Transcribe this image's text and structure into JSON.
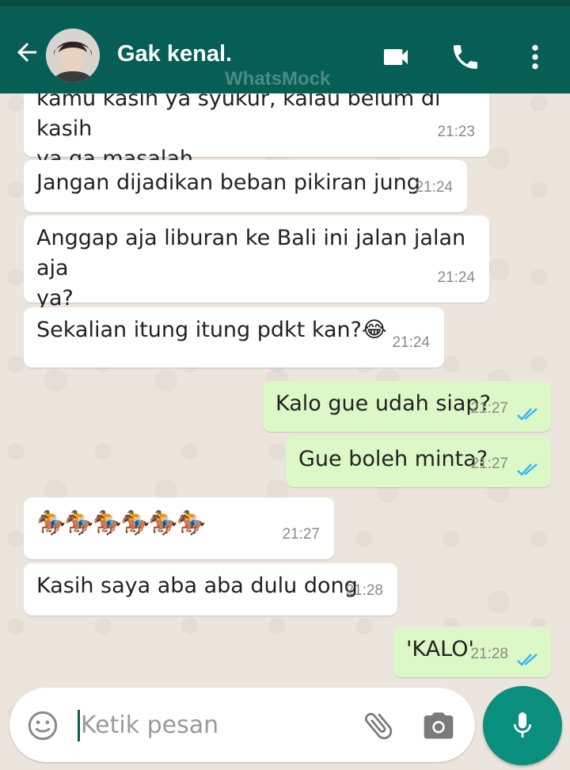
{
  "header": {
    "contact_name": "Gak kenal.",
    "watermark": "WhatsMock",
    "icons": [
      "back-arrow-icon",
      "video-call-icon",
      "phone-icon",
      "more-vert-icon"
    ]
  },
  "messages": [
    {
      "dir": "in",
      "text_line1": "kamu kasih ya syukur, kalau belum di kasih",
      "text_line2": "ya ga masalah",
      "time": "21:23"
    },
    {
      "dir": "in",
      "text": "Jangan dijadikan beban pikiran jung",
      "time": "21:24"
    },
    {
      "dir": "in",
      "text_line1": "Anggap aja liburan ke Bali ini jalan jalan aja",
      "text_line2": "ya?",
      "time": "21:24"
    },
    {
      "dir": "in",
      "text": "Sekalian itung itung pdkt kan?😂",
      "time": "21:24"
    },
    {
      "dir": "out",
      "text": "Kalo gue udah siap?",
      "time": "21:27",
      "status": "read"
    },
    {
      "dir": "out",
      "text": "Gue boleh minta?",
      "time": "21:27",
      "status": "read"
    },
    {
      "dir": "in",
      "text": "🏇🏇🏇🏇🏇🏇",
      "time": "21:27"
    },
    {
      "dir": "in",
      "text": "Kasih saya aba aba dulu dong",
      "time": "21:28"
    },
    {
      "dir": "out",
      "text": "'KALO'",
      "time": "21:28",
      "status": "read"
    }
  ],
  "composer": {
    "placeholder": "Ketik pesan",
    "value": ""
  },
  "colors": {
    "header": "#075e54",
    "incoming": "#ffffff",
    "outgoing": "#dcf8c6",
    "read_ticks": "#34b7f1",
    "mic_button": "#0a8f7f"
  }
}
